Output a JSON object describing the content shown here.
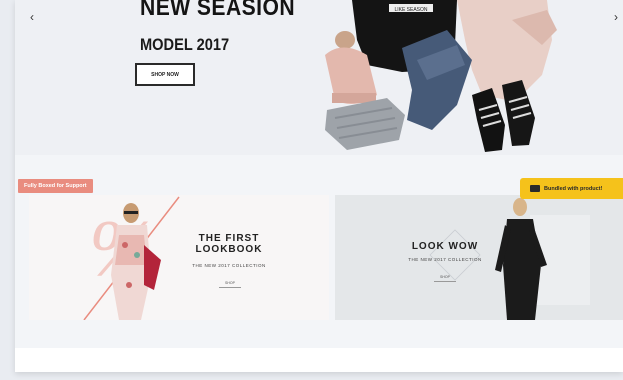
{
  "hero": {
    "title": "NEW SEASION",
    "subtitle": "MODEL 2017",
    "button_label": "SHOP NOW",
    "prev_icon": "chevron-left-icon",
    "next_icon": "chevron-right-icon",
    "shirt_text": "LIKE SEASON"
  },
  "banner_left": {
    "badge": "Fully Boxed for Support",
    "title_line1": "THE FIRST",
    "title_line2": "LOOKBOOK",
    "subtitle": "THE NEW 2017 COLLECTION",
    "button_label": "SHOP"
  },
  "banner_right": {
    "badge": "Bundled with product!",
    "badge_icon": "tag-icon",
    "title": "LOOK WOW",
    "subtitle": "THE NEW 2017 COLLECTION",
    "button_label": "SHOP"
  },
  "colors": {
    "badge_left": "#e98c7f",
    "badge_right": "#f5c21b",
    "accent_stroke": "#e98c7f"
  }
}
